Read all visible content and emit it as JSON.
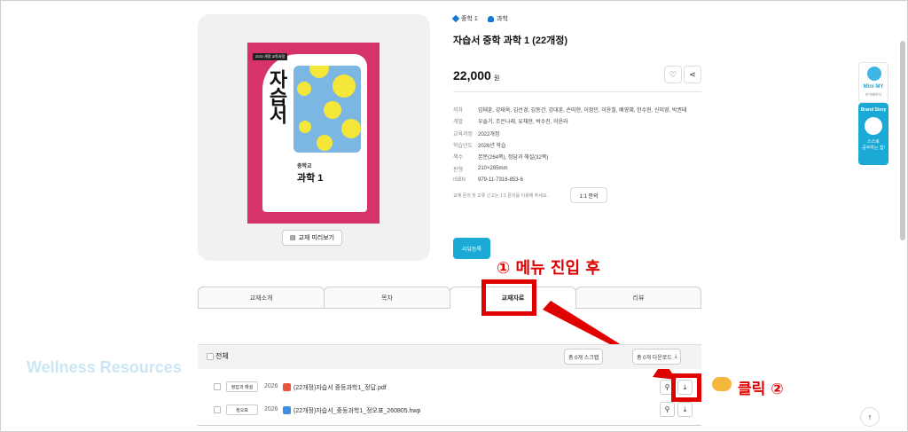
{
  "categories": [
    "중학 1",
    "과학"
  ],
  "product": {
    "title": "자습서 중학 과학 1 (22개정)",
    "price": "22,000",
    "price_unit": "원"
  },
  "book_cover": {
    "tag": "2022 개정 교육과정",
    "title": "자습서",
    "subject_small": "중학교",
    "subject_big": "과학 1"
  },
  "preview_button": "교재 미리보기",
  "meta": [
    {
      "key": "저자",
      "value": "임태훈, 강태욱, 김선경, 김동건, 강대훈, 손미현, 이정민, 이윤철, 배영혜, 한수현, 신미영, 박권태"
    },
    {
      "key": "개발",
      "value": "우솔기, 조은나래, 유채현, 박수진, 이윤라"
    },
    {
      "key": "교육과정",
      "value": "2022개정"
    },
    {
      "key": "학습년도",
      "value": "2026년 학습"
    },
    {
      "key": "책수",
      "value": "본문(264쪽), 정답과 해설(32쪽)"
    },
    {
      "key": "판형",
      "value": "210×285mm"
    },
    {
      "key": "ISBN",
      "value": "979-11-7316-853-6"
    }
  ],
  "notice": "교재 문의 및 오류 신고는 1:1 문의를 이용해 주세요.",
  "qa_button": "1:1 문의",
  "review_button": "리뷰등록",
  "annotations": {
    "step1": "① 메뉴 진입 후",
    "step2": "클릭 ②"
  },
  "tabs": [
    "교재소개",
    "목차",
    "교재자료",
    "리뷰"
  ],
  "active_tab": "교재자료",
  "list": {
    "select_all": "전체",
    "scrap_all": "총 0개 스크랩",
    "download_all": "총 0개 다운로드"
  },
  "files": [
    {
      "badge": "정답과 해설",
      "year": "2026",
      "name": "(22개정)자습서 중등과학1_정답.pdf",
      "type": "pdf"
    },
    {
      "badge": "정오표",
      "year": "2026",
      "name": "(22개정)자습서_중등과학1_정오표_260805.hwp",
      "type": "hwp"
    }
  ],
  "watermark": "Wellness Resources",
  "side": {
    "mini_title": "Mini MY",
    "mini_sub": "마이페이지",
    "brand_title": "Brand Story",
    "brand_text1": "스스로",
    "brand_text2": "공부하는 힘!"
  },
  "colors": {
    "accent": "#1ba9d6",
    "annotation": "#e00000",
    "book_pink": "#d6336c"
  }
}
